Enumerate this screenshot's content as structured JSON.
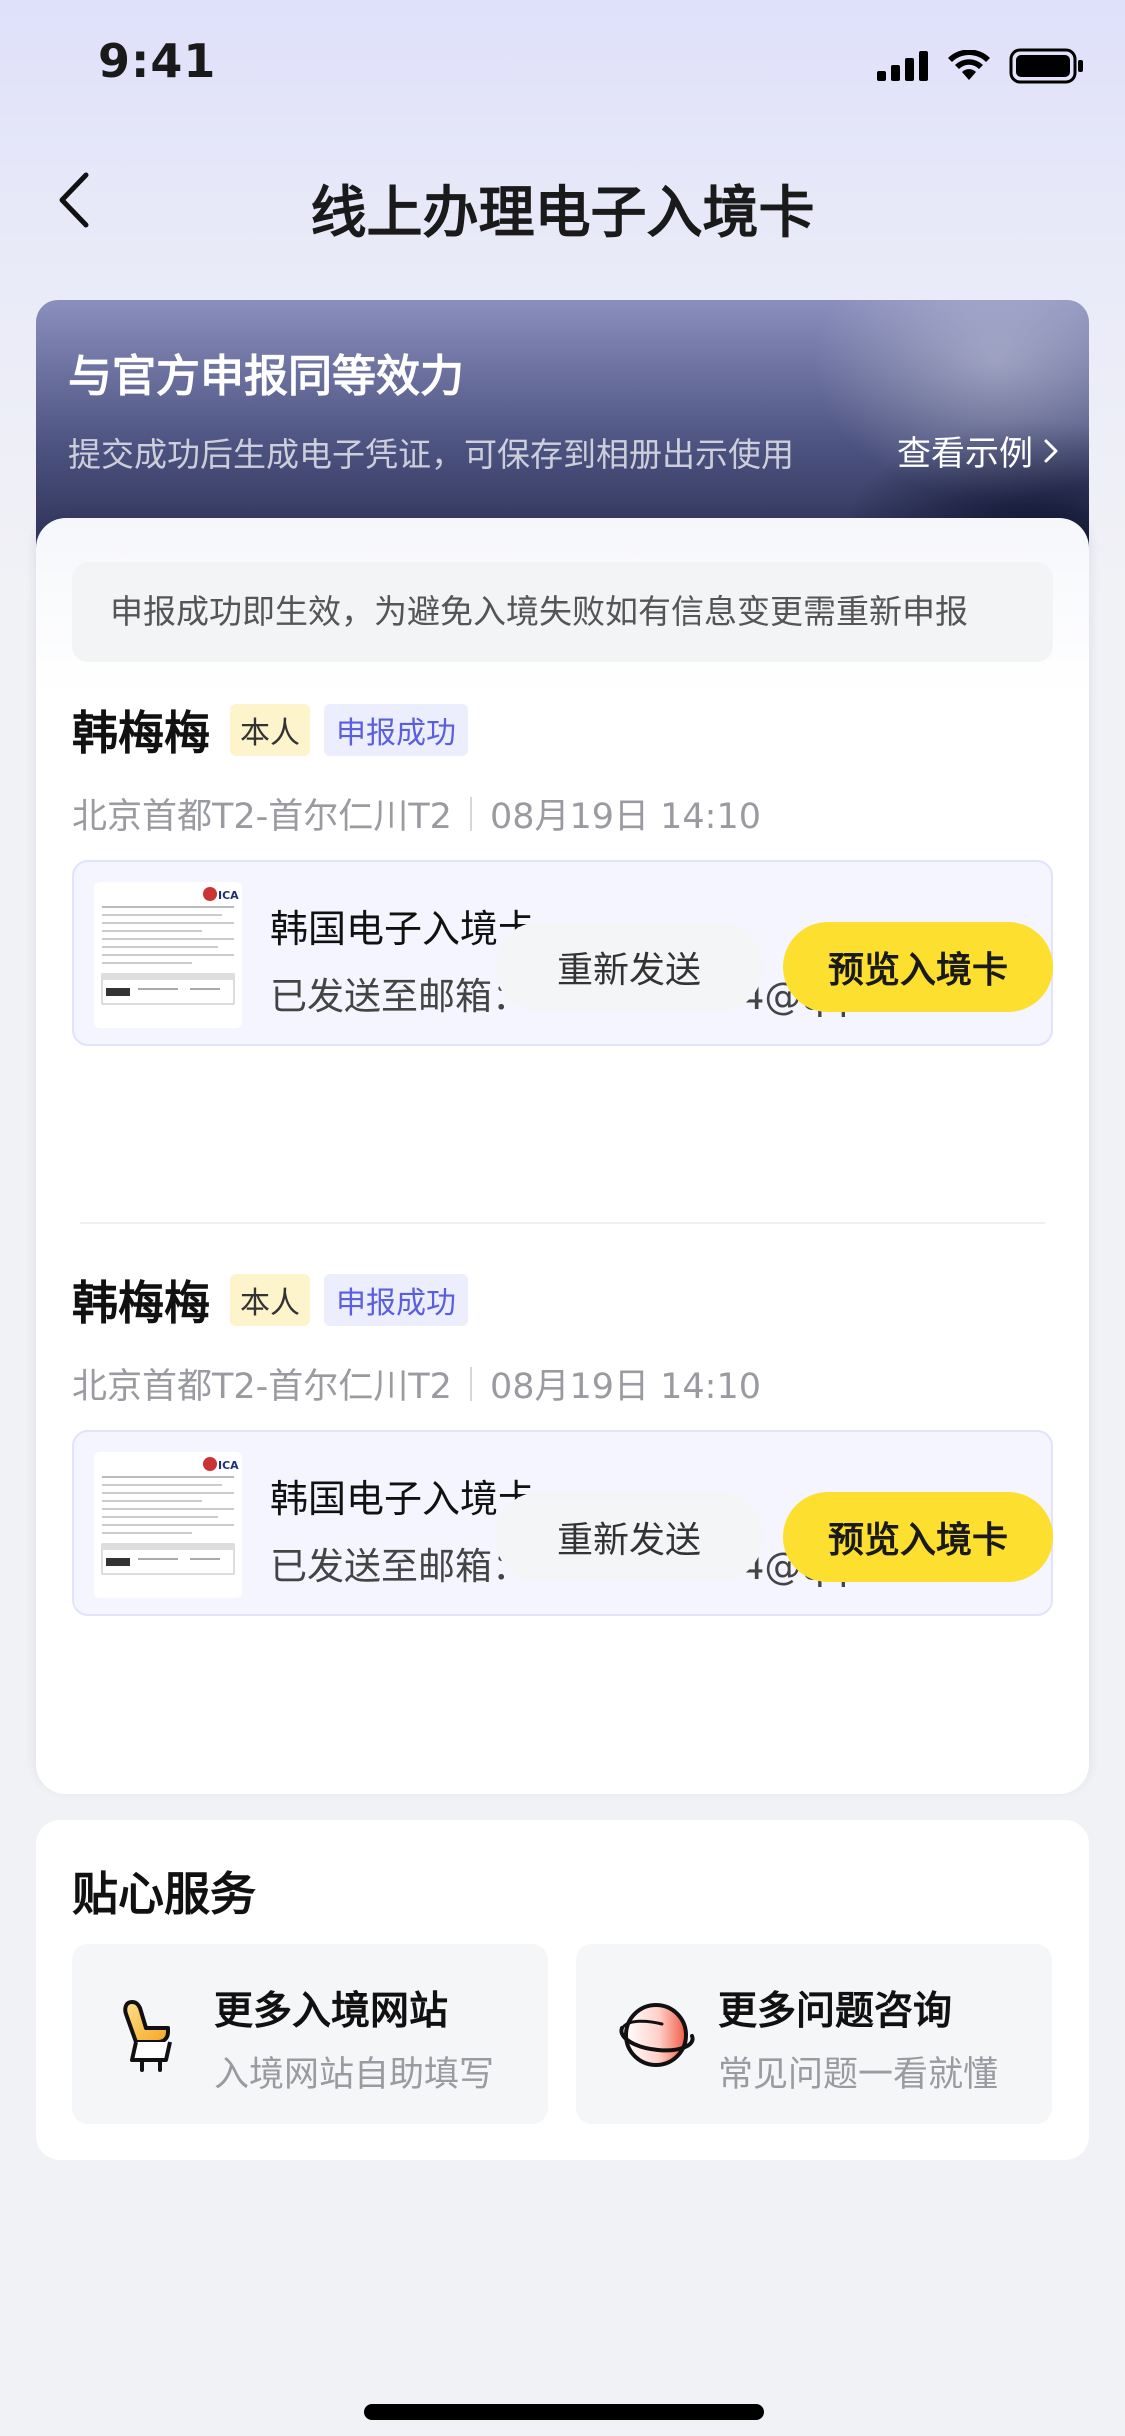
{
  "status_bar": {
    "time": "9:41"
  },
  "nav": {
    "title": "线上办理电子入境卡"
  },
  "banner": {
    "title": "与官方申报同等效力",
    "subtitle": "提交成功后生成电子凭证，可保存到相册出示使用",
    "link": "查看示例"
  },
  "notice": "申报成功即生效，为避免入境失败如有信息变更需重新申报",
  "entries": [
    {
      "name": "韩梅梅",
      "tag_self": "本人",
      "tag_status": "申报成功",
      "route": "北京首都T2-首尔仁川T2",
      "datetime": "08月19日 14:10",
      "doc_title": "韩国电子入境卡",
      "doc_email": "已发送至邮箱：7890300774@qq.com",
      "resend_label": "重新发送",
      "preview_label": "预览入境卡"
    },
    {
      "name": "韩梅梅",
      "tag_self": "本人",
      "tag_status": "申报成功",
      "route": "北京首都T2-首尔仁川T2",
      "datetime": "08月19日 14:10",
      "doc_title": "韩国电子入境卡",
      "doc_email": "已发送至邮箱：7890300774@qq.com",
      "resend_label": "重新发送",
      "preview_label": "预览入境卡"
    }
  ],
  "services": {
    "title": "贴心服务",
    "items": [
      {
        "title": "更多入境网站",
        "subtitle": "入境网站自助填写",
        "icon": "seat-icon"
      },
      {
        "title": "更多问题咨询",
        "subtitle": "常见问题一看就懂",
        "icon": "planet-icon"
      }
    ]
  },
  "colors": {
    "accent_yellow": "#fde02f",
    "status_blue": "#5a5fe0",
    "banner_dark": "#262b4d"
  }
}
